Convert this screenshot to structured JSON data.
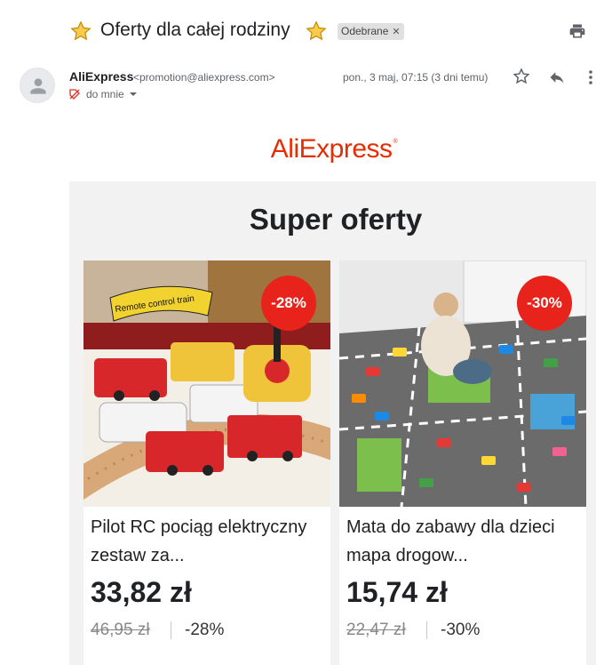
{
  "email": {
    "subject": "Oferty dla całej rodziny",
    "label": "Odebrane",
    "sender_name": "AliExpress",
    "sender_email": "<promotion@aliexpress.com>",
    "to": "do mnie",
    "date": "pon., 3 maj, 07:15 (3 dni temu)"
  },
  "body": {
    "brand": "AliExpress",
    "brand_tm": "®",
    "heading": "Super oferty",
    "products": [
      {
        "image_text": "Remote control train",
        "discount_badge": "-28%",
        "name": "Pilot RC pociąg elektryczny zestaw za...",
        "price": "33,82 zł",
        "old_price": "46,95 zł",
        "discount": "-28%"
      },
      {
        "discount_badge": "-30%",
        "name": "Mata do zabawy dla dzieci mapa drogow...",
        "price": "15,74 zł",
        "old_price": "22,47 zł",
        "discount": "-30%"
      }
    ]
  },
  "colors": {
    "brand_red": "#e62e04",
    "badge_red": "#e8231b",
    "star_yellow": "#f7cb4d"
  },
  "icons": [
    "star-icon",
    "close-icon",
    "print-icon",
    "avatar-icon",
    "tag-icon",
    "chevron-down-icon",
    "star-outline-icon",
    "reply-icon",
    "more-vert-icon"
  ]
}
